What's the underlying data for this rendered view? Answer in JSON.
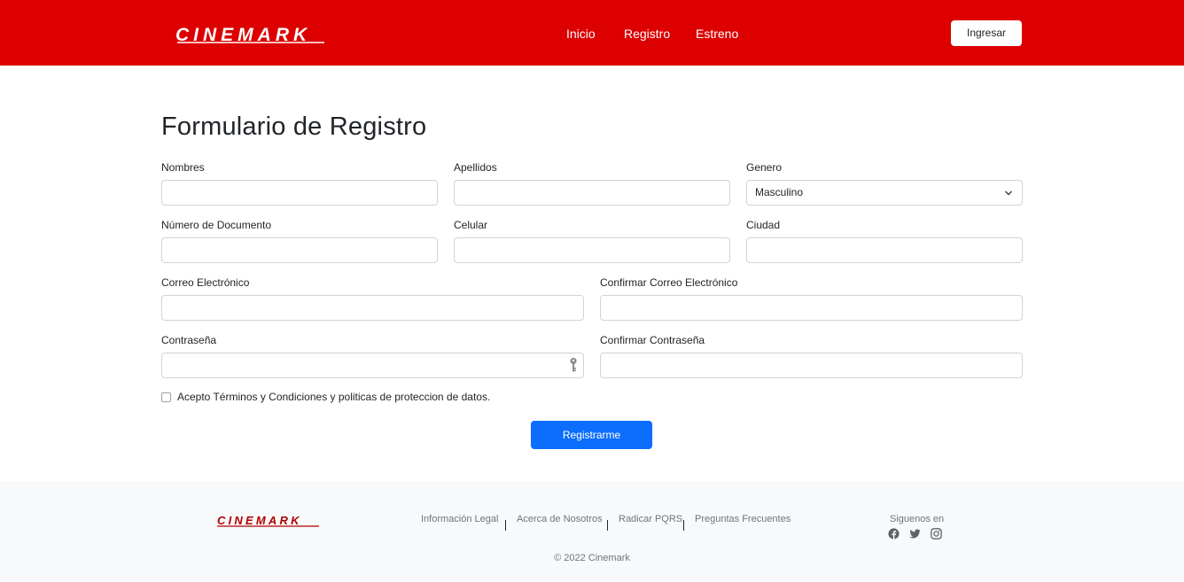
{
  "header": {
    "brand": "CINEMARK",
    "nav": [
      "Inicio",
      "Registro",
      "Estreno"
    ],
    "login_button": "Ingresar"
  },
  "form": {
    "title": "Formulario de Registro",
    "fields": {
      "nombres": {
        "label": "Nombres",
        "value": ""
      },
      "apellidos": {
        "label": "Apellidos",
        "value": ""
      },
      "genero": {
        "label": "Genero",
        "value": "Masculino"
      },
      "documento": {
        "label": "Número de Documento",
        "value": ""
      },
      "celular": {
        "label": "Celular",
        "value": ""
      },
      "ciudad": {
        "label": "Ciudad",
        "value": ""
      },
      "correo": {
        "label": "Correo Electrónico",
        "value": ""
      },
      "confirmar_correo": {
        "label": "Confirmar Correo Electrónico",
        "value": ""
      },
      "contrasena": {
        "label": "Contraseña",
        "value": ""
      },
      "confirmar_contrasena": {
        "label": "Confirmar Contraseña",
        "value": ""
      }
    },
    "terms_label": "Acepto Términos y Condiciones y politicas de proteccion de datos.",
    "terms_checked": false,
    "submit_label": "Registrarme"
  },
  "footer": {
    "brand": "CINEMARK",
    "links": [
      "Información Legal",
      "Acerca de Nosotros",
      "Radicar PQRS",
      "Preguntas Frecuentes"
    ],
    "follow_label": "Siguenos en",
    "social_icons": [
      "facebook-icon",
      "twitter-icon",
      "instagram-icon"
    ],
    "copyright": "© 2022 Cinemark"
  },
  "colors": {
    "brand_red": "#dc0000",
    "primary_blue": "#0d6efd",
    "footer_bg": "#f8f9fa",
    "border": "#ced4da"
  }
}
